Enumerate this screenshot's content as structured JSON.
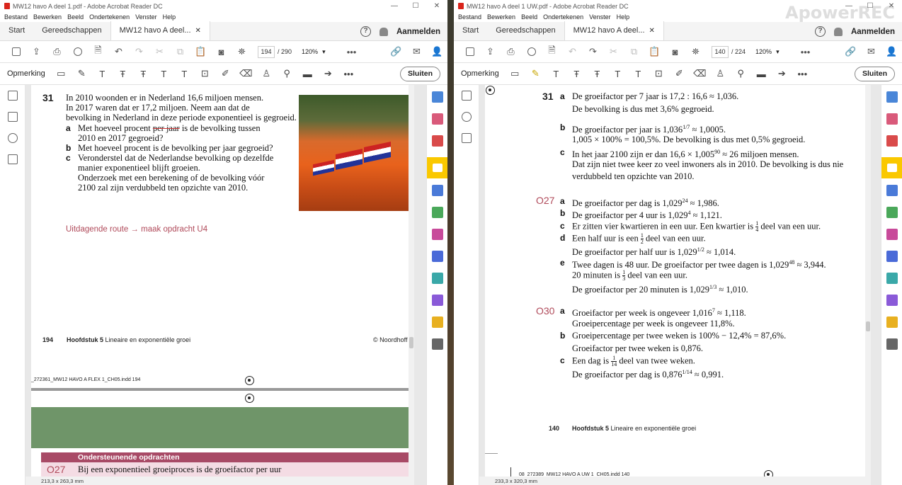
{
  "left": {
    "window_title": "MW12 havo A deel 1.pdf - Adobe Acrobat Reader DC",
    "menu": [
      "Bestand",
      "Bewerken",
      "Beeld",
      "Ondertekenen",
      "Venster",
      "Help"
    ],
    "tabs": {
      "start": "Start",
      "tools": "Gereedschappen",
      "doc": "MW12 havo A deel..."
    },
    "signin": "Aanmelden",
    "page_current": "194",
    "page_total": "/ 290",
    "zoom": "120%",
    "comment_label": "Opmerking",
    "close_label": "Sluiten",
    "ex_number": "31",
    "ex_lines": [
      "In 2010 woonden er in Nederland 16,6 miljoen mensen.",
      "In 2017 waren dat er 17,2 miljoen. Neem aan dat de",
      "bevolking in Nederland in deze periode exponentieel is gegroeid."
    ],
    "a_label": "a",
    "a_line1_pre": "Met hoeveel procent ",
    "a_line1_strike": "per jaar",
    "a_line1_post": " is de bevolking tussen",
    "a_line2": "2010 en 2017 gegroeid?",
    "b_label": "b",
    "b_line": "Met hoeveel procent is de bevolking per jaar gegroeid?",
    "c_label": "c",
    "c_lines": [
      "Veronderstel dat de Nederlandse bevolking op dezelfde",
      "manier exponentieel blijft groeien.",
      "Onderzoek met een berekening of de bevolking vóór",
      "2100 zal zijn verdubbeld ten opzichte van 2010."
    ],
    "route": "Uitdagende route → maak opdracht U4",
    "footer_page": "194",
    "footer_chapter_bold": "Hoofdstuk 5",
    "footer_chapter": " Lineaire en exponentiële groei",
    "footer_copy": "© Noordhoff",
    "indd": "_272361_MW12 HAVO A FLEX 1_CH05.indd   194",
    "support_header": "Ondersteunende opdrachten",
    "next_ex": "O27",
    "next_ex_text": "Bij een exponentieel groeiproces is de groeifactor per uur",
    "page_size": "213,3 x 263,3 mm"
  },
  "right": {
    "window_title": "MW12 havo A deel 1 UW.pdf - Adobe Acrobat Reader DC",
    "menu": [
      "Bestand",
      "Bewerken",
      "Beeld",
      "Ondertekenen",
      "Venster",
      "Help"
    ],
    "tabs": {
      "start": "Start",
      "tools": "Gereedschappen",
      "doc": "MW12 havo A deel..."
    },
    "signin": "Aanmelden",
    "page_current": "140",
    "page_total": "/ 224",
    "zoom": "120%",
    "comment_label": "Opmerking",
    "close_label": "Sluiten",
    "watermark": "ApowerREC",
    "ex31": "31",
    "ex31_a_label": "a",
    "ex31_a": [
      "De groeifactor per 7 jaar is 17,2 : 16,6 ≈ 1,036.",
      "De bevolking is dus met 3,6% gegroeid."
    ],
    "ex31_b_label": "b",
    "ex31_b1": "De groeifactor per jaar is 1,036",
    "ex31_b1_exp": "1/7",
    "ex31_b1_post": " ≈ 1,0005.",
    "ex31_b2": "1,005 × 100% = 100,5%. De bevolking is dus met 0,5% gegroeid.",
    "ex31_c_label": "c",
    "ex31_c1": "In het jaar 2100 zijn er dan 16,6 × 1,005",
    "ex31_c1_exp": "90",
    "ex31_c1_post": " ≈ 26 miljoen mensen.",
    "ex31_c2": "Dat zijn niet twee keer zo veel inwoners als in 2010. De bevolking is dus nie",
    "ex31_c3": "verdubbeld ten opzichte van 2010.",
    "ex27": "O27",
    "ex27_a_label": "a",
    "ex27_a": "De groeifactor per dag is 1,029",
    "ex27_a_exp": "24",
    "ex27_a_post": " ≈ 1,986.",
    "ex27_b_label": "b",
    "ex27_b": "De groeifactor per 4 uur is 1,029",
    "ex27_b_exp": "4",
    "ex27_b_post": " ≈ 1,121.",
    "ex27_c_label": "c",
    "ex27_c": "Er zitten vier kwartieren in een uur. Een kwartier is ",
    "ex27_c_num": "1",
    "ex27_c_den": "4",
    "ex27_c_post": " deel van een uur.",
    "ex27_d_label": "d",
    "ex27_d1": "Een half uur is een ",
    "ex27_d1_num": "1",
    "ex27_d1_den": "2",
    "ex27_d1_post": " deel van een uur.",
    "ex27_d2": "De groeifactor per half uur is 1,029",
    "ex27_d2_exp": "1/2",
    "ex27_d2_post": " ≈ 1,014.",
    "ex27_e_label": "e",
    "ex27_e1": "Twee dagen is 48 uur. De groeifactor per twee dagen is 1,029",
    "ex27_e1_exp": "48",
    "ex27_e1_post": " ≈ 3,944.",
    "ex27_e2": "20 minuten is ",
    "ex27_e2_num": "1",
    "ex27_e2_den": "3",
    "ex27_e2_post": " deel van een uur.",
    "ex27_e3": "De groeifactor per 20 minuten is 1,029",
    "ex27_e3_exp": "1/3",
    "ex27_e3_post": " ≈ 1,010.",
    "ex30": "O30",
    "ex30_a_label": "a",
    "ex30_a1": "Groeifactor per week is ongeveer 1,016",
    "ex30_a1_exp": "7",
    "ex30_a1_post": " ≈ 1,118.",
    "ex30_a2": "Groeipercentage per week is ongeveer 11,8%.",
    "ex30_b_label": "b",
    "ex30_b1": "Groeipercentage per twee weken is 100% − 12,4% = 87,6%.",
    "ex30_b2": "Groeifactor per twee weken is 0,876.",
    "ex30_c_label": "c",
    "ex30_c1": "Een dag is ",
    "ex30_c1_num": "1",
    "ex30_c1_den": "14",
    "ex30_c1_post": " deel van twee weken.",
    "ex30_c2": "De groeifactor per dag is 0,876",
    "ex30_c2_exp": "1/14",
    "ex30_c2_post": " ≈ 0,991.",
    "footer_page": "140",
    "footer_chapter_bold": "Hoofdstuk 5",
    "footer_chapter": " Lineaire en exponentiële groei",
    "indd": "08_272389_MW12 HAVO A UW 1_CH05.indd   140",
    "page_size": "233,3 x 320,3 mm"
  },
  "colors": {
    "accent_yellow": "#fac800",
    "route_pink": "#b04a5a",
    "banner_pink": "#a84a66",
    "green_block": "#6f9569"
  }
}
